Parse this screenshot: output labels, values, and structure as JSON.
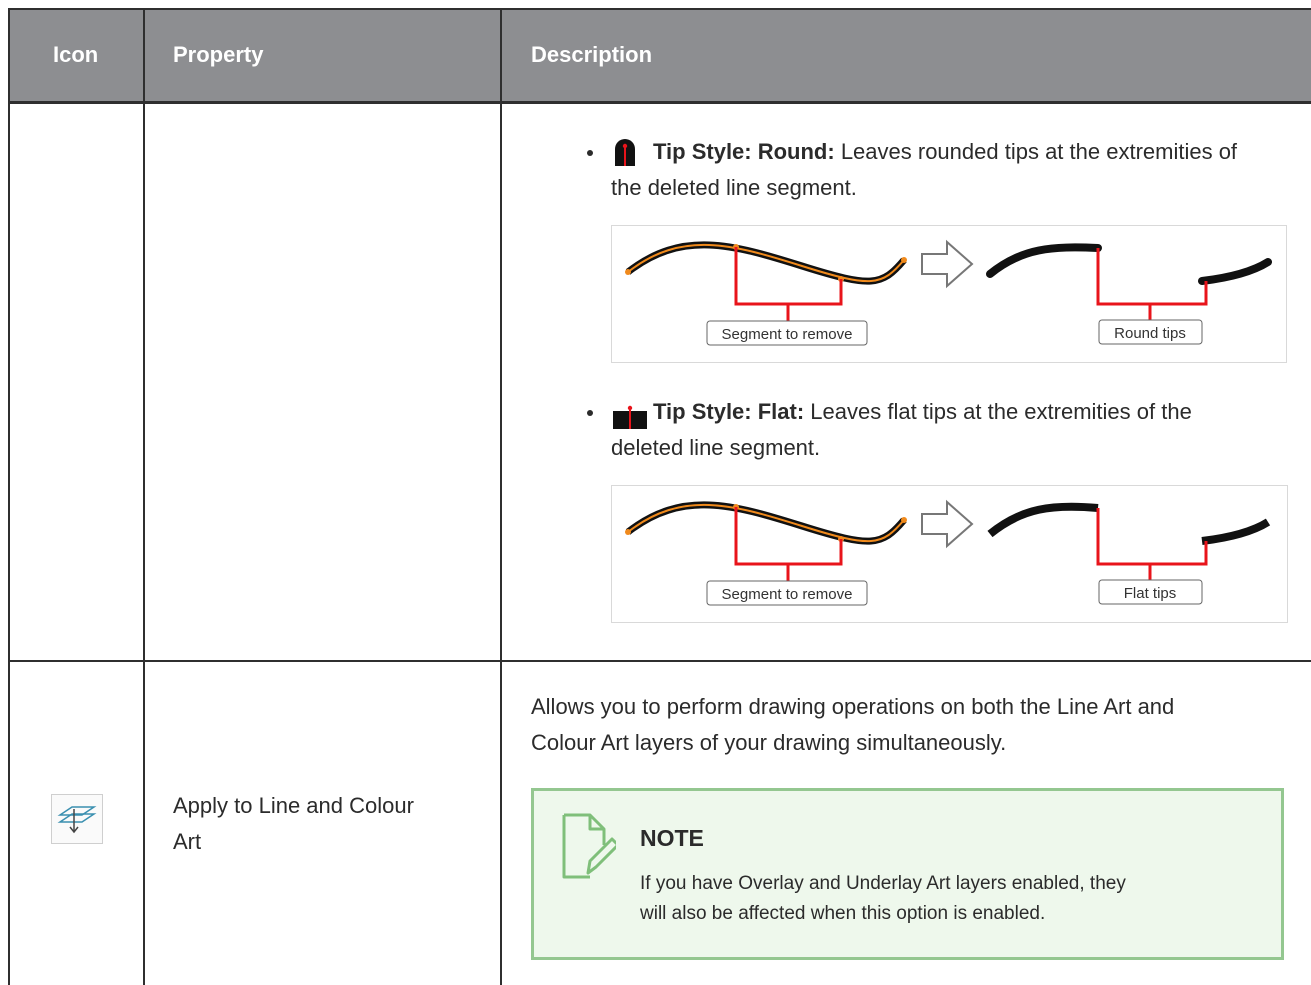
{
  "header": {
    "col_icon": "Icon",
    "col_property": "Property",
    "col_description": "Description"
  },
  "row1": {
    "bullet1": {
      "icon": "round-tip-icon",
      "label": "Tip Style: Round:",
      "text_line1": " Leaves rounded tips at the extremities of",
      "text_line2": "the deleted line segment.",
      "fig_left_label": "Segment to remove",
      "fig_right_label": "Round tips"
    },
    "bullet2": {
      "icon": "flat-tip-icon",
      "label": "Tip Style: Flat:",
      "text_line1": " Leaves flat tips at the extremities of the",
      "text_line2": "deleted line segment.",
      "fig_left_label": "Segment to remove",
      "fig_right_label": "Flat tips"
    }
  },
  "row2": {
    "icon": "apply-to-line-and-colour-art-icon",
    "property_line1": "Apply to Line and Colour",
    "property_line2": "Art",
    "desc_line1": "Allows you to perform drawing operations on both the Line Art and",
    "desc_line2": "Colour Art layers of your drawing simultaneously.",
    "note": {
      "icon": "note-pencil-icon",
      "title": "NOTE",
      "text_line1": "If you have Overlay and Underlay Art layers enabled, they",
      "text_line2": "will also be affected when this option is enabled."
    }
  },
  "colors": {
    "header_bg": "#8d8e91",
    "note_bg": "#eef8ec",
    "note_border": "#94c790",
    "segment_red": "#e8141b",
    "stroke_orange": "#f08a1c"
  }
}
